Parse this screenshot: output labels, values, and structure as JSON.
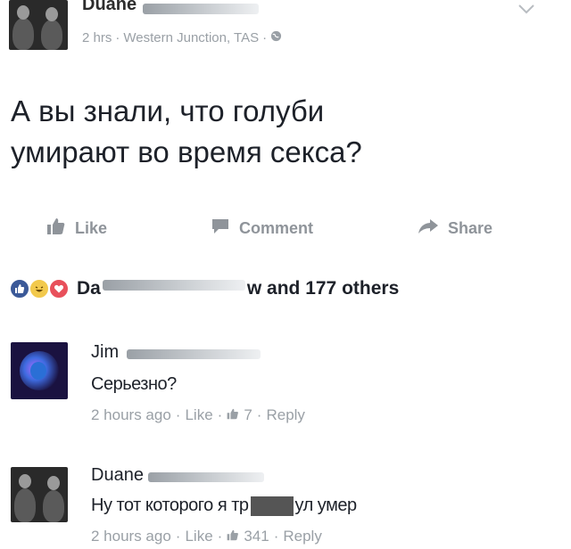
{
  "post": {
    "author": "Duane",
    "time": "2 hrs",
    "separator": "·",
    "location": "Western Junction, TAS",
    "privacy_icon": "globe-icon",
    "text_line1": "А вы знали, что голуби",
    "text_line2": "умирают во время секса?"
  },
  "actions": {
    "like": "Like",
    "comment": "Comment",
    "share": "Share"
  },
  "reactions": {
    "prefix": "Da",
    "suffix": "w and 177 others",
    "icons": [
      "like-reaction-icon",
      "haha-reaction-icon",
      "love-reaction-icon"
    ]
  },
  "comments": [
    {
      "author": "Jim",
      "text": "Серьезно?",
      "time": "2 hours ago",
      "like": "Like",
      "likes": "7",
      "reply": "Reply"
    },
    {
      "author": "Duane",
      "text_before": "Ну тот которого я тр",
      "text_after": "ул умер",
      "time": "2 hours ago",
      "like": "Like",
      "likes": "341",
      "reply": "Reply"
    }
  ],
  "colors": {
    "text": "#1d2129",
    "muted": "#9aa0a6",
    "like_blue": "#3b5998",
    "love_red": "#e8505b",
    "haha_yellow": "#f2c94c"
  }
}
